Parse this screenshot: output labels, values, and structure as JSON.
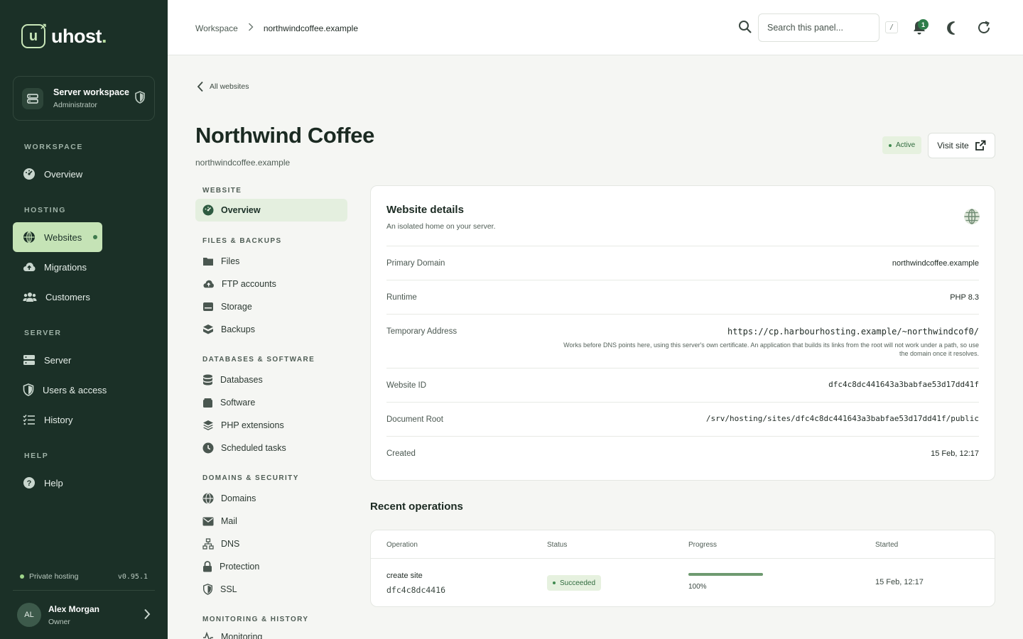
{
  "brand": {
    "name": "uhost",
    "dot": "."
  },
  "workspace": {
    "title": "Server workspace",
    "role": "Administrator"
  },
  "sidebar": {
    "sections": {
      "workspace": "WORKSPACE",
      "hosting": "HOSTING",
      "server": "SERVER",
      "help": "HELP"
    },
    "items": {
      "overview": "Overview",
      "websites": "Websites",
      "migrations": "Migrations",
      "customers": "Customers",
      "server": "Server",
      "users_access": "Users & access",
      "history": "History",
      "help": "Help"
    }
  },
  "footer": {
    "status": "Private hosting",
    "version": "v0.95.1"
  },
  "user": {
    "initials": "AL",
    "name": "Alex Morgan",
    "role": "Owner"
  },
  "topbar": {
    "crumb_root": "Workspace",
    "crumb_current": "northwindcoffee.example",
    "search_placeholder": "Search this panel...",
    "shortcut": "/",
    "notifications": "1"
  },
  "page": {
    "back_label": "All websites",
    "title": "Northwind Coffee",
    "subtitle": "northwindcoffee.example",
    "status": "Active",
    "visit_label": "Visit site"
  },
  "subnav": {
    "sections": {
      "website": "WEBSITE",
      "files": "FILES & BACKUPS",
      "databases": "DATABASES & SOFTWARE",
      "domains": "DOMAINS & SECURITY",
      "monitoring": "MONITORING & HISTORY"
    },
    "items": {
      "overview": "Overview",
      "files": "Files",
      "ftp": "FTP accounts",
      "storage": "Storage",
      "backups": "Backups",
      "databases": "Databases",
      "software": "Software",
      "php_ext": "PHP extensions",
      "tasks": "Scheduled tasks",
      "domains": "Domains",
      "mail": "Mail",
      "dns": "DNS",
      "protection": "Protection",
      "ssl": "SSL",
      "monitoring": "Monitoring"
    }
  },
  "details": {
    "title": "Website details",
    "subtitle": "An isolated home on your server.",
    "rows": {
      "primary_domain": {
        "label": "Primary Domain",
        "value": "northwindcoffee.example"
      },
      "runtime": {
        "label": "Runtime",
        "value": "PHP 8.3"
      },
      "temp_address": {
        "label": "Temporary Address",
        "value": "https://cp.harbourhosting.example/~northwindcof0/",
        "note": "Works before DNS points here, using this server's own certificate. An application that builds its links from the root will not work under a path, so use the domain once it resolves."
      },
      "website_id": {
        "label": "Website ID",
        "value": "dfc4c8dc441643a3babfae53d17dd41f"
      },
      "doc_root": {
        "label": "Document Root",
        "value": "/srv/hosting/sites/dfc4c8dc441643a3babfae53d17dd41f/public"
      },
      "created": {
        "label": "Created",
        "value": "15 Feb, 12:17"
      }
    }
  },
  "operations": {
    "title": "Recent operations",
    "columns": {
      "operation": "Operation",
      "status": "Status",
      "progress": "Progress",
      "started": "Started"
    },
    "rows": [
      {
        "operation": "create site",
        "id": "dfc4c8dc4416",
        "status": "Succeeded",
        "progress": 1.0,
        "progress_label": "100%",
        "started": "15 Feb, 12:17"
      }
    ]
  },
  "colors": {
    "sidebar": "#1b3027",
    "accent": "#c5e3b6",
    "success": "#2f7d4a"
  }
}
